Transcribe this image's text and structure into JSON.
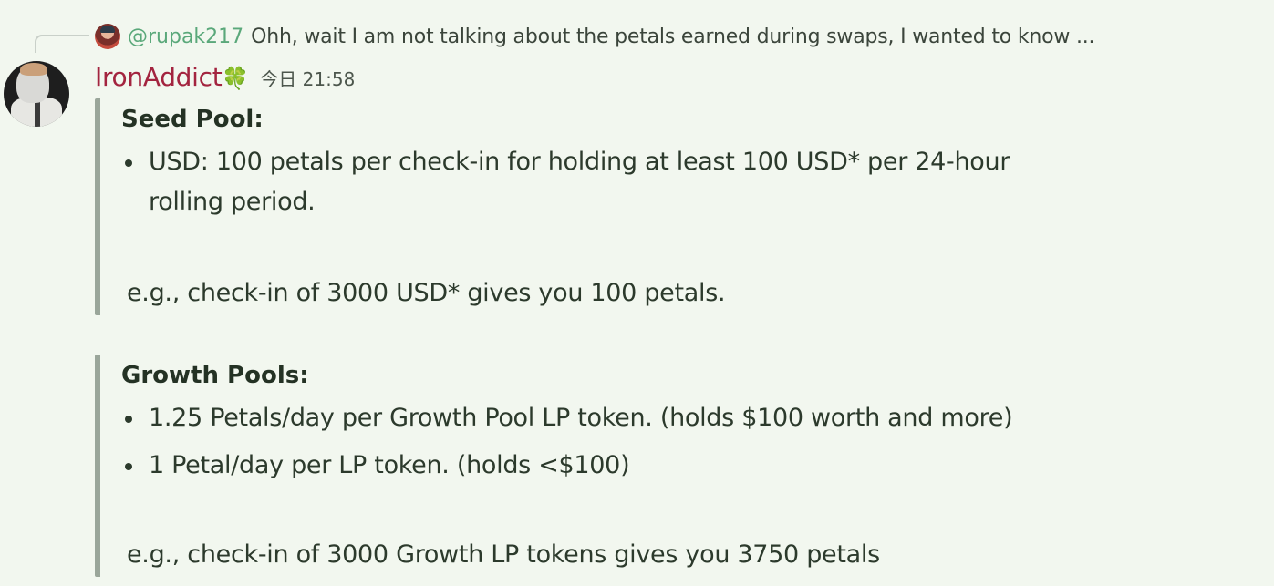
{
  "reply": {
    "username": "@rupak217",
    "text": "Ohh, wait I am not talking about the petals earned during swaps, I wanted to know ..."
  },
  "message": {
    "username": "IronAddict",
    "badge_emoji": "🍀",
    "timestamp": "今日 21:58"
  },
  "seed_pool": {
    "title": "Seed Pool:",
    "items": [
      "USD: 100 petals per check-in for holding at least 100 USD* per 24-hour rolling period."
    ],
    "example": "e.g., check-in of 3000 USD* gives you 100 petals."
  },
  "growth_pools": {
    "title": "Growth Pools:",
    "items": [
      "1.25 Petals/day per Growth Pool LP token. (holds $100 worth and more)",
      "1 Petal/day per LP token. (holds <$100)"
    ],
    "example": "e.g., check-in of 3000 Growth LP tokens gives you 3750 petals"
  },
  "colors": {
    "background": "#f2f7ef",
    "reply_username": "#5aa87a",
    "username": "#a3243f",
    "quote_bar": "#9aa69a"
  }
}
